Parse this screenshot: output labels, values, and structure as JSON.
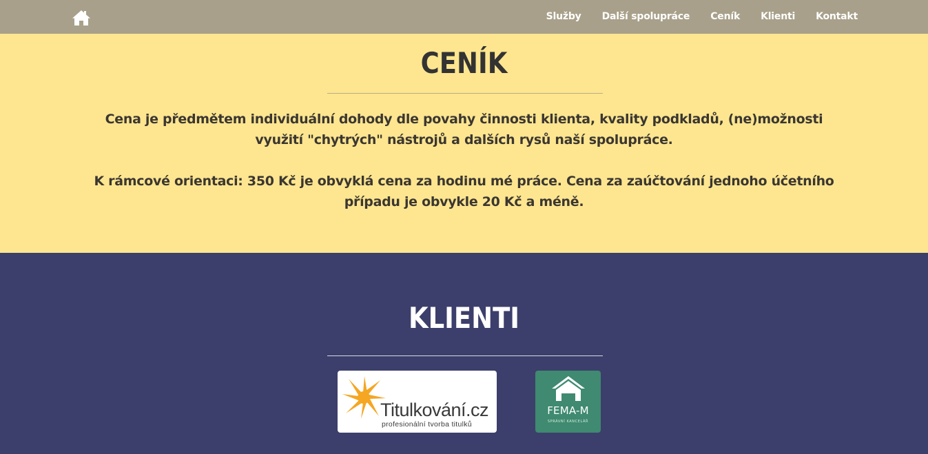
{
  "nav": {
    "home_icon": "home-icon",
    "items": [
      {
        "label": "Služby"
      },
      {
        "label": "Další spolupráce"
      },
      {
        "label": "Ceník"
      },
      {
        "label": "Klienti"
      },
      {
        "label": "Kontakt"
      }
    ]
  },
  "cenik": {
    "title": "CENÍK",
    "paragraph1": "Cena je předmětem individuální dohody dle povahy činnosti klienta, kvality podkladů, (ne)možnosti využití \"chytrých\" nástrojů a dalších rysů naší spolupráce.",
    "paragraph2": "K rámcové orientaci: 350 Kč je obvyklá cena za hodinu mé práce. Cena za zaúčtování jednoho účetního případu je obvykle 20 Kč a méně."
  },
  "klienti": {
    "title": "KLIENTI",
    "clients": [
      {
        "name": "Titulkování.cz",
        "tagline": "profesionální tvorba titulků"
      },
      {
        "name": "FEMA-M",
        "tagline": "SPRÁVNÍ KANCELÁŘ"
      }
    ]
  },
  "colors": {
    "navbar": "#a8a08a",
    "cenik_bg": "#fde68f",
    "klienti_bg": "#3c3f6b",
    "fema_green": "#3f8a70",
    "tit_star": "#f5a623"
  }
}
